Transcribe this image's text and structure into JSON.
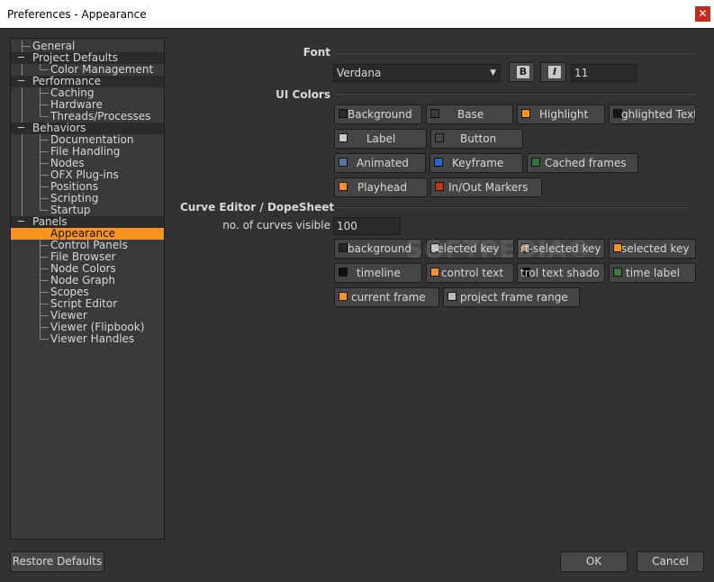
{
  "window": {
    "title": "Preferences - Appearance",
    "close_glyph": "✕"
  },
  "tree": {
    "items": [
      {
        "label": "General",
        "group": false,
        "toggle": ""
      },
      {
        "label": "Project Defaults",
        "group": true,
        "toggle": "−"
      },
      {
        "label": "Color Management",
        "group": false,
        "toggle": ""
      },
      {
        "label": "Performance",
        "group": true,
        "toggle": "−"
      },
      {
        "label": "Caching",
        "group": false,
        "toggle": ""
      },
      {
        "label": "Hardware",
        "group": false,
        "toggle": ""
      },
      {
        "label": "Threads/Processes",
        "group": false,
        "toggle": ""
      },
      {
        "label": "Behaviors",
        "group": true,
        "toggle": "−"
      },
      {
        "label": "Documentation",
        "group": false,
        "toggle": ""
      },
      {
        "label": "File Handling",
        "group": false,
        "toggle": ""
      },
      {
        "label": "Nodes",
        "group": false,
        "toggle": ""
      },
      {
        "label": "OFX Plug-ins",
        "group": false,
        "toggle": ""
      },
      {
        "label": "Positions",
        "group": false,
        "toggle": ""
      },
      {
        "label": "Scripting",
        "group": false,
        "toggle": ""
      },
      {
        "label": "Startup",
        "group": false,
        "toggle": ""
      },
      {
        "label": "Panels",
        "group": true,
        "toggle": "−"
      },
      {
        "label": "Appearance",
        "group": false,
        "toggle": "",
        "selected": true
      },
      {
        "label": "Control Panels",
        "group": false,
        "toggle": ""
      },
      {
        "label": "File Browser",
        "group": false,
        "toggle": ""
      },
      {
        "label": "Node Colors",
        "group": false,
        "toggle": ""
      },
      {
        "label": "Node Graph",
        "group": false,
        "toggle": ""
      },
      {
        "label": "Scopes",
        "group": false,
        "toggle": ""
      },
      {
        "label": "Script Editor",
        "group": false,
        "toggle": ""
      },
      {
        "label": "Viewer",
        "group": false,
        "toggle": ""
      },
      {
        "label": "Viewer (Flipbook)",
        "group": false,
        "toggle": ""
      },
      {
        "label": "Viewer Handles",
        "group": false,
        "toggle": ""
      }
    ]
  },
  "font": {
    "section_label": "Font",
    "family": "Verdana",
    "bold_glyph": "B",
    "italic_glyph": "I",
    "size": "11"
  },
  "ui_colors": {
    "section_label": "UI Colors",
    "buttons": [
      {
        "label": "Background",
        "swatch": "#2b2b2b"
      },
      {
        "label": "Base",
        "swatch": "#3a3a3a"
      },
      {
        "label": "Highlight",
        "swatch": "#f7931e"
      },
      {
        "label": "ghlighted Text",
        "swatch": "#161616"
      },
      {
        "label": "Label",
        "swatch": "#cccccc"
      },
      {
        "label": "Button",
        "swatch": "#474747"
      },
      {
        "label": "Animated",
        "swatch": "#5577a0"
      },
      {
        "label": "Keyframe",
        "swatch": "#2c66c8"
      },
      {
        "label": "Cached frames",
        "swatch": "#3a6e3a"
      },
      {
        "label": "Playhead",
        "swatch": "#f7931e"
      },
      {
        "label": "In/Out Markers",
        "swatch": "#c03818"
      }
    ]
  },
  "curve_editor": {
    "section_label": "Curve Editor / DopeSheet",
    "curves_label": "no. of curves visible",
    "curves_value": "100",
    "buttons": [
      {
        "label": "background",
        "swatch": "#262626"
      },
      {
        "label": "selected key",
        "swatch": "#bbbbbb"
      },
      {
        "label": "rt-selected key",
        "swatch": "#a08770"
      },
      {
        "label": "selected key",
        "swatch": "#f7931e"
      },
      {
        "label": "timeline",
        "swatch": "#111111"
      },
      {
        "label": "control text",
        "swatch": "#f7931e"
      },
      {
        "label": "trol text shado",
        "swatch": "#000000"
      },
      {
        "label": "time label",
        "swatch": "#3a7a3a"
      },
      {
        "label": "current frame",
        "swatch": "#f7931e"
      },
      {
        "label": "project frame range",
        "swatch": "#bbbbbb"
      }
    ]
  },
  "watermark": "SOFTPEDIA®",
  "footer": {
    "restore_label": "Restore Defaults",
    "ok_label": "OK",
    "cancel_label": "Cancel"
  }
}
